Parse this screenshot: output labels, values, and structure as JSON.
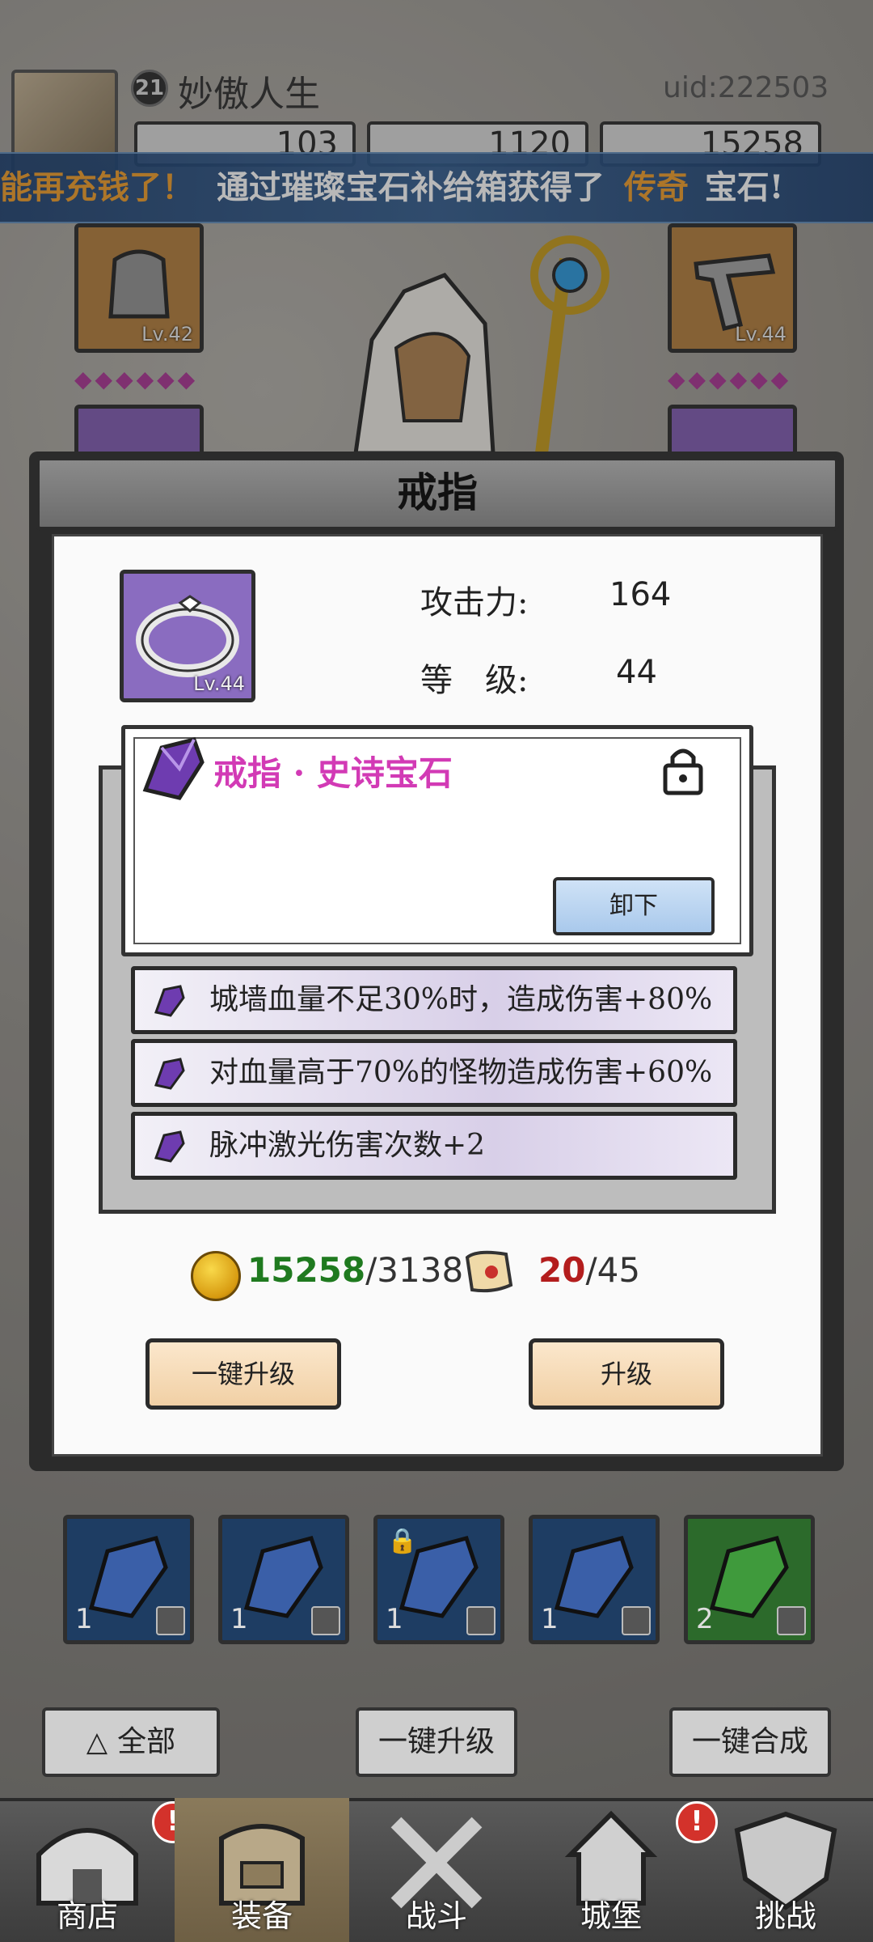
{
  "player": {
    "level": "21",
    "name": "妙傲人生",
    "uid": "uid:222503"
  },
  "currencies": [
    {
      "name": "gold-gem",
      "value": "103",
      "color": "#e8c21a"
    },
    {
      "name": "purple-gem",
      "value": "1120",
      "color": "#9b6fd6"
    },
    {
      "name": "gold-coin",
      "value": "15258",
      "color": "#e0a612"
    }
  ],
  "banner": {
    "prefix": "能再充钱了！",
    "middle": "通过璀璨宝石补给箱获得了",
    "highlight": "传奇",
    "suffix": "宝石!"
  },
  "equipment_slots": {
    "left_top_lv": "Lv.42",
    "right_top_lv": "Lv.44"
  },
  "modal": {
    "title": "戒指",
    "item_lv": "Lv.44",
    "attack_label": "攻击力:",
    "attack_value": "164",
    "level_label": "等　级:",
    "level_value": "44",
    "gem_name": "戒指 · 史诗宝石",
    "unequip_label": "卸下",
    "effects": [
      "城墙血量不足30%时，造成伤害+80%",
      "对血量高于70%的怪物造成伤害+60%",
      "脉冲激光伤害次数+2"
    ],
    "coin_have": "15258",
    "coin_need": "/3138",
    "scroll_have": "20",
    "scroll_need": "/45",
    "btn_one_key_upgrade": "一键升级",
    "btn_upgrade": "升级"
  },
  "inventory": [
    {
      "count": "1",
      "color": "blue"
    },
    {
      "count": "1",
      "color": "blue"
    },
    {
      "count": "1",
      "color": "blue",
      "locked": true
    },
    {
      "count": "1",
      "color": "blue"
    },
    {
      "count": "2",
      "color": "green"
    }
  ],
  "bottom_buttons": {
    "all": "全部",
    "upgrade_all": "一键升级",
    "merge_all": "一键合成"
  },
  "nav": [
    {
      "label": "商店",
      "alert": "!"
    },
    {
      "label": "装备",
      "alert": ""
    },
    {
      "label": "战斗",
      "alert": ""
    },
    {
      "label": "城堡",
      "alert": "!"
    },
    {
      "label": "挑战",
      "alert": ""
    }
  ]
}
